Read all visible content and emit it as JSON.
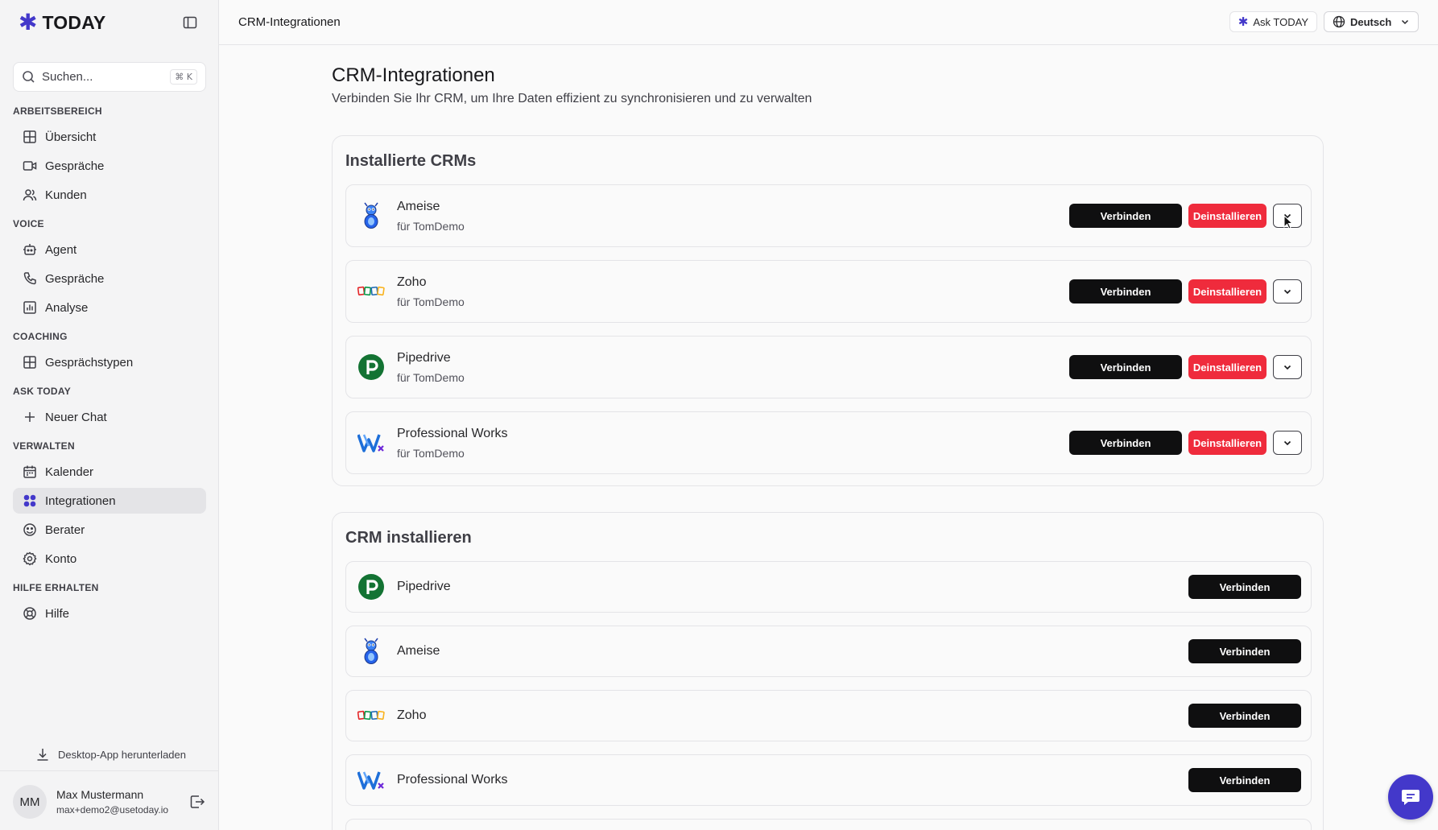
{
  "app": {
    "brand": "TODAY",
    "brand_color": "#4338ca"
  },
  "sidebar": {
    "search": {
      "placeholder": "Suchen...",
      "shortcut": "⌘ K"
    },
    "sections": {
      "workspace": {
        "label": "ARBEITSBEREICH",
        "items": [
          "Übersicht",
          "Gespräche",
          "Kunden"
        ]
      },
      "voice": {
        "label": "VOICE",
        "items": [
          "Agent",
          "Gespräche",
          "Analyse"
        ]
      },
      "coaching": {
        "label": "COACHING",
        "items": [
          "Gesprächstypen"
        ]
      },
      "ask": {
        "label": "ASK TODAY",
        "items": [
          "Neuer Chat"
        ]
      },
      "manage": {
        "label": "VERWALTEN",
        "items": [
          "Kalender",
          "Integrationen",
          "Berater",
          "Konto"
        ]
      },
      "help": {
        "label": "HILFE ERHALTEN",
        "items": [
          "Hilfe"
        ]
      }
    },
    "active_item": "Integrationen",
    "download_label": "Desktop-App herunterladen",
    "user": {
      "initials": "MM",
      "name": "Max Mustermann",
      "email": "max+demo2@usetoday.io"
    }
  },
  "topbar": {
    "breadcrumb": "CRM-Integrationen",
    "ask_label": "Ask TODAY",
    "language": "Deutsch"
  },
  "main": {
    "title": "CRM-Integrationen",
    "subtitle": "Verbinden Sie Ihr CRM, um Ihre Daten effizient zu synchronisieren und zu verwalten",
    "installed": {
      "title": "Installierte CRMs",
      "items": [
        {
          "name": "Ameise",
          "owner": "für TomDemo",
          "logo": "ameise-logo"
        },
        {
          "name": "Zoho",
          "owner": "für TomDemo",
          "logo": "zoho-logo"
        },
        {
          "name": "Pipedrive",
          "owner": "für TomDemo",
          "logo": "pipedrive-logo"
        },
        {
          "name": "Professional Works",
          "owner": "für TomDemo",
          "logo": "professional-works-logo"
        }
      ],
      "connect_label": "Verbinden",
      "uninstall_label": "Deinstallieren"
    },
    "install": {
      "title": "CRM installieren",
      "items": [
        {
          "name": "Pipedrive",
          "logo": "pipedrive-logo"
        },
        {
          "name": "Ameise",
          "logo": "ameise-logo"
        },
        {
          "name": "Zoho",
          "logo": "zoho-logo"
        },
        {
          "name": "Professional Works",
          "logo": "professional-works-logo"
        }
      ],
      "connect_label": "Verbinden"
    }
  },
  "colors": {
    "danger": "#ef2b3c",
    "dark_button": "#0f0f10",
    "chat_fab": "#4338ca"
  }
}
